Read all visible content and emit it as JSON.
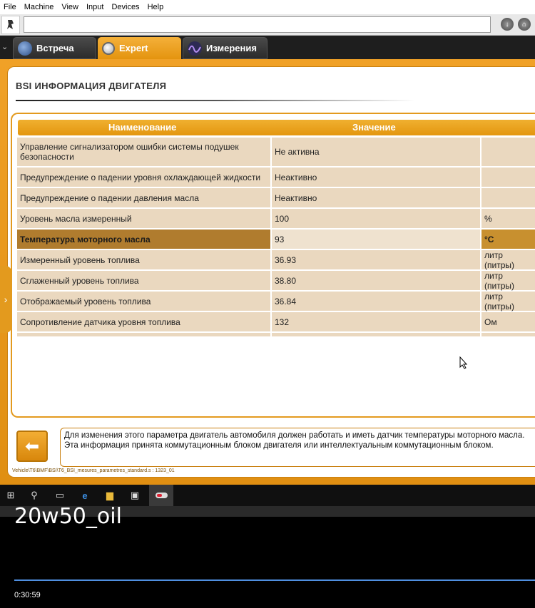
{
  "menu": [
    "File",
    "Machine",
    "View",
    "Input",
    "Devices",
    "Help"
  ],
  "tabs": [
    {
      "label": "Встреча",
      "icon": "globe-icon"
    },
    {
      "label": "Expert",
      "icon": "magnifier-icon"
    },
    {
      "label": "Измерения",
      "icon": "waveform-icon"
    }
  ],
  "page_title": "BSI  ИНФОРМАЦИЯ ДВИГАТЕЛЯ",
  "table": {
    "col_name": "Наименование",
    "col_value": "Значение",
    "rows": [
      {
        "name": "Управление сигнализатором ошибки системы подушек безопасности",
        "value": "Не активна",
        "unit": ""
      },
      {
        "name": "Предупреждение о падении уровня охлаждающей жидкости",
        "value": "Неактивно",
        "unit": ""
      },
      {
        "name": "Предупреждение о падении давления масла",
        "value": "Неактивно",
        "unit": ""
      },
      {
        "name": "Уровень масла измеренный",
        "value": "100",
        "unit": "%"
      },
      {
        "name": "Температура моторного масла",
        "value": "93",
        "unit": "°C"
      },
      {
        "name": "Измеренный уровень топлива",
        "value": "36.93",
        "unit": "литр (питры)"
      },
      {
        "name": "Сглаженный уровень топлива",
        "value": "38.80",
        "unit": "литр (питры)"
      },
      {
        "name": "Отображаемый уровень топлива",
        "value": "36.84",
        "unit": "литр (питры)"
      },
      {
        "name": "Сопротивление датчика уровня топлива",
        "value": "132",
        "unit": "Ом"
      }
    ]
  },
  "info_text": "Для изменения этого параметра двигатель автомобиля должен работать и иметь датчик температуры моторного масла. Эта информация принята коммутационным блоком двигателя или интеллектуальным коммутационным блоком.",
  "file_path": "Vehicle\\T6\\BMF\\BSI\\T6_BSI_mesures_parametres_standard.s : 1323_01",
  "video": {
    "title": "20w50_oil",
    "time": "0:30:59"
  },
  "colors": {
    "accent": "#e8991a",
    "row_bg": "#ead8bf",
    "selected_row": "#b07c2e"
  }
}
